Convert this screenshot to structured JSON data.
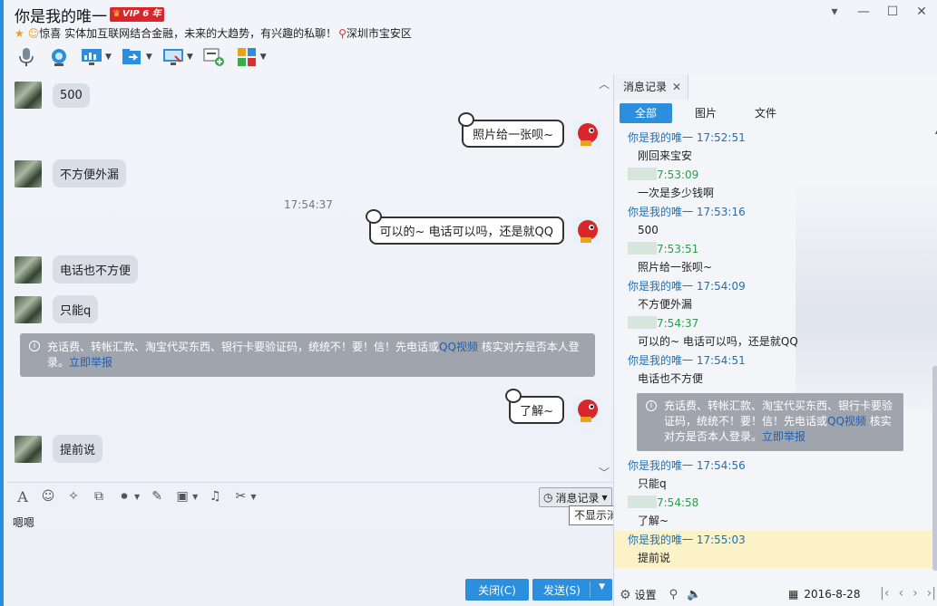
{
  "header": {
    "title": "你是我的唯一",
    "vip_badge": "VIP 6 年",
    "status_text": "惊喜 实体加互联网结合金融，未来的大趋势，有兴趣的私聊！",
    "location": "深圳市宝安区"
  },
  "colors": {
    "accent": "#2b8fdd",
    "window_border": "#2a8ee0",
    "warning_bg": "#a0a4ad",
    "link": "#1e5fb4",
    "highlight": "#fbf2c8"
  },
  "chat": {
    "messages": [
      {
        "side": "in",
        "text": "500"
      },
      {
        "side": "out",
        "text": "照片给一张呗~"
      },
      {
        "side": "in",
        "text": "不方便外漏"
      },
      {
        "side": "out",
        "text": "可以的~ 电话可以吗，还是就QQ"
      },
      {
        "side": "in",
        "text": "电话也不方便"
      },
      {
        "side": "in",
        "text": "只能q"
      },
      {
        "side": "out",
        "text": "了解~"
      },
      {
        "side": "in",
        "text": "提前说"
      }
    ],
    "timestamp": "17:54:37",
    "warning": {
      "text": "充话费、转帐汇款、淘宝代买东西、银行卡要验证码，统统不！要！信！先电话或",
      "link1": "QQ视频",
      "text2": "核实对方是否本人登录。",
      "link2": "立即举报"
    }
  },
  "input": {
    "history_button": "消息记录",
    "tooltip": "不显示消息记录",
    "draft": "嗯嗯",
    "close_button": "关闭(C)",
    "send_button": "发送(S)"
  },
  "panel": {
    "tab_label": "消息记录",
    "filters": [
      "全部",
      "图片",
      "文件"
    ],
    "records": [
      {
        "who": "你是我的唯一",
        "time": "17:52:51",
        "text": "刚回来宝安",
        "mine": false
      },
      {
        "who": "",
        "time": "7:53:09",
        "text": "一次是多少钱啊",
        "mine": true
      },
      {
        "who": "你是我的唯一",
        "time": "17:53:16",
        "text": "500",
        "mine": false
      },
      {
        "who": "",
        "time": "7:53:51",
        "text": "照片给一张呗~",
        "mine": true
      },
      {
        "who": "你是我的唯一",
        "time": "17:54:09",
        "text": "不方便外漏",
        "mine": false
      },
      {
        "who": "",
        "time": "7:54:37",
        "text": "可以的~ 电话可以吗，还是就QQ",
        "mine": true
      },
      {
        "who": "你是我的唯一",
        "time": "17:54:51",
        "text": "电话也不方便",
        "mine": false
      }
    ],
    "warning": {
      "text": "充话费、转帐汇款、淘宝代买东西、银行卡要验证码，统统不！要！信！先电话或",
      "link1": "QQ视频",
      "text2": "核实对方是否本人登录。",
      "link2": "立即举报"
    },
    "records2": [
      {
        "who": "你是我的唯一",
        "time": "17:54:56",
        "text": "只能q",
        "mine": false
      },
      {
        "who": "",
        "time": "7:54:58",
        "text": "了解~",
        "mine": true
      },
      {
        "who": "你是我的唯一",
        "time": "17:55:03",
        "text": "提前说",
        "mine": false,
        "highlight": true
      }
    ],
    "footer": {
      "settings": "设置",
      "date": "2016-8-28"
    }
  }
}
